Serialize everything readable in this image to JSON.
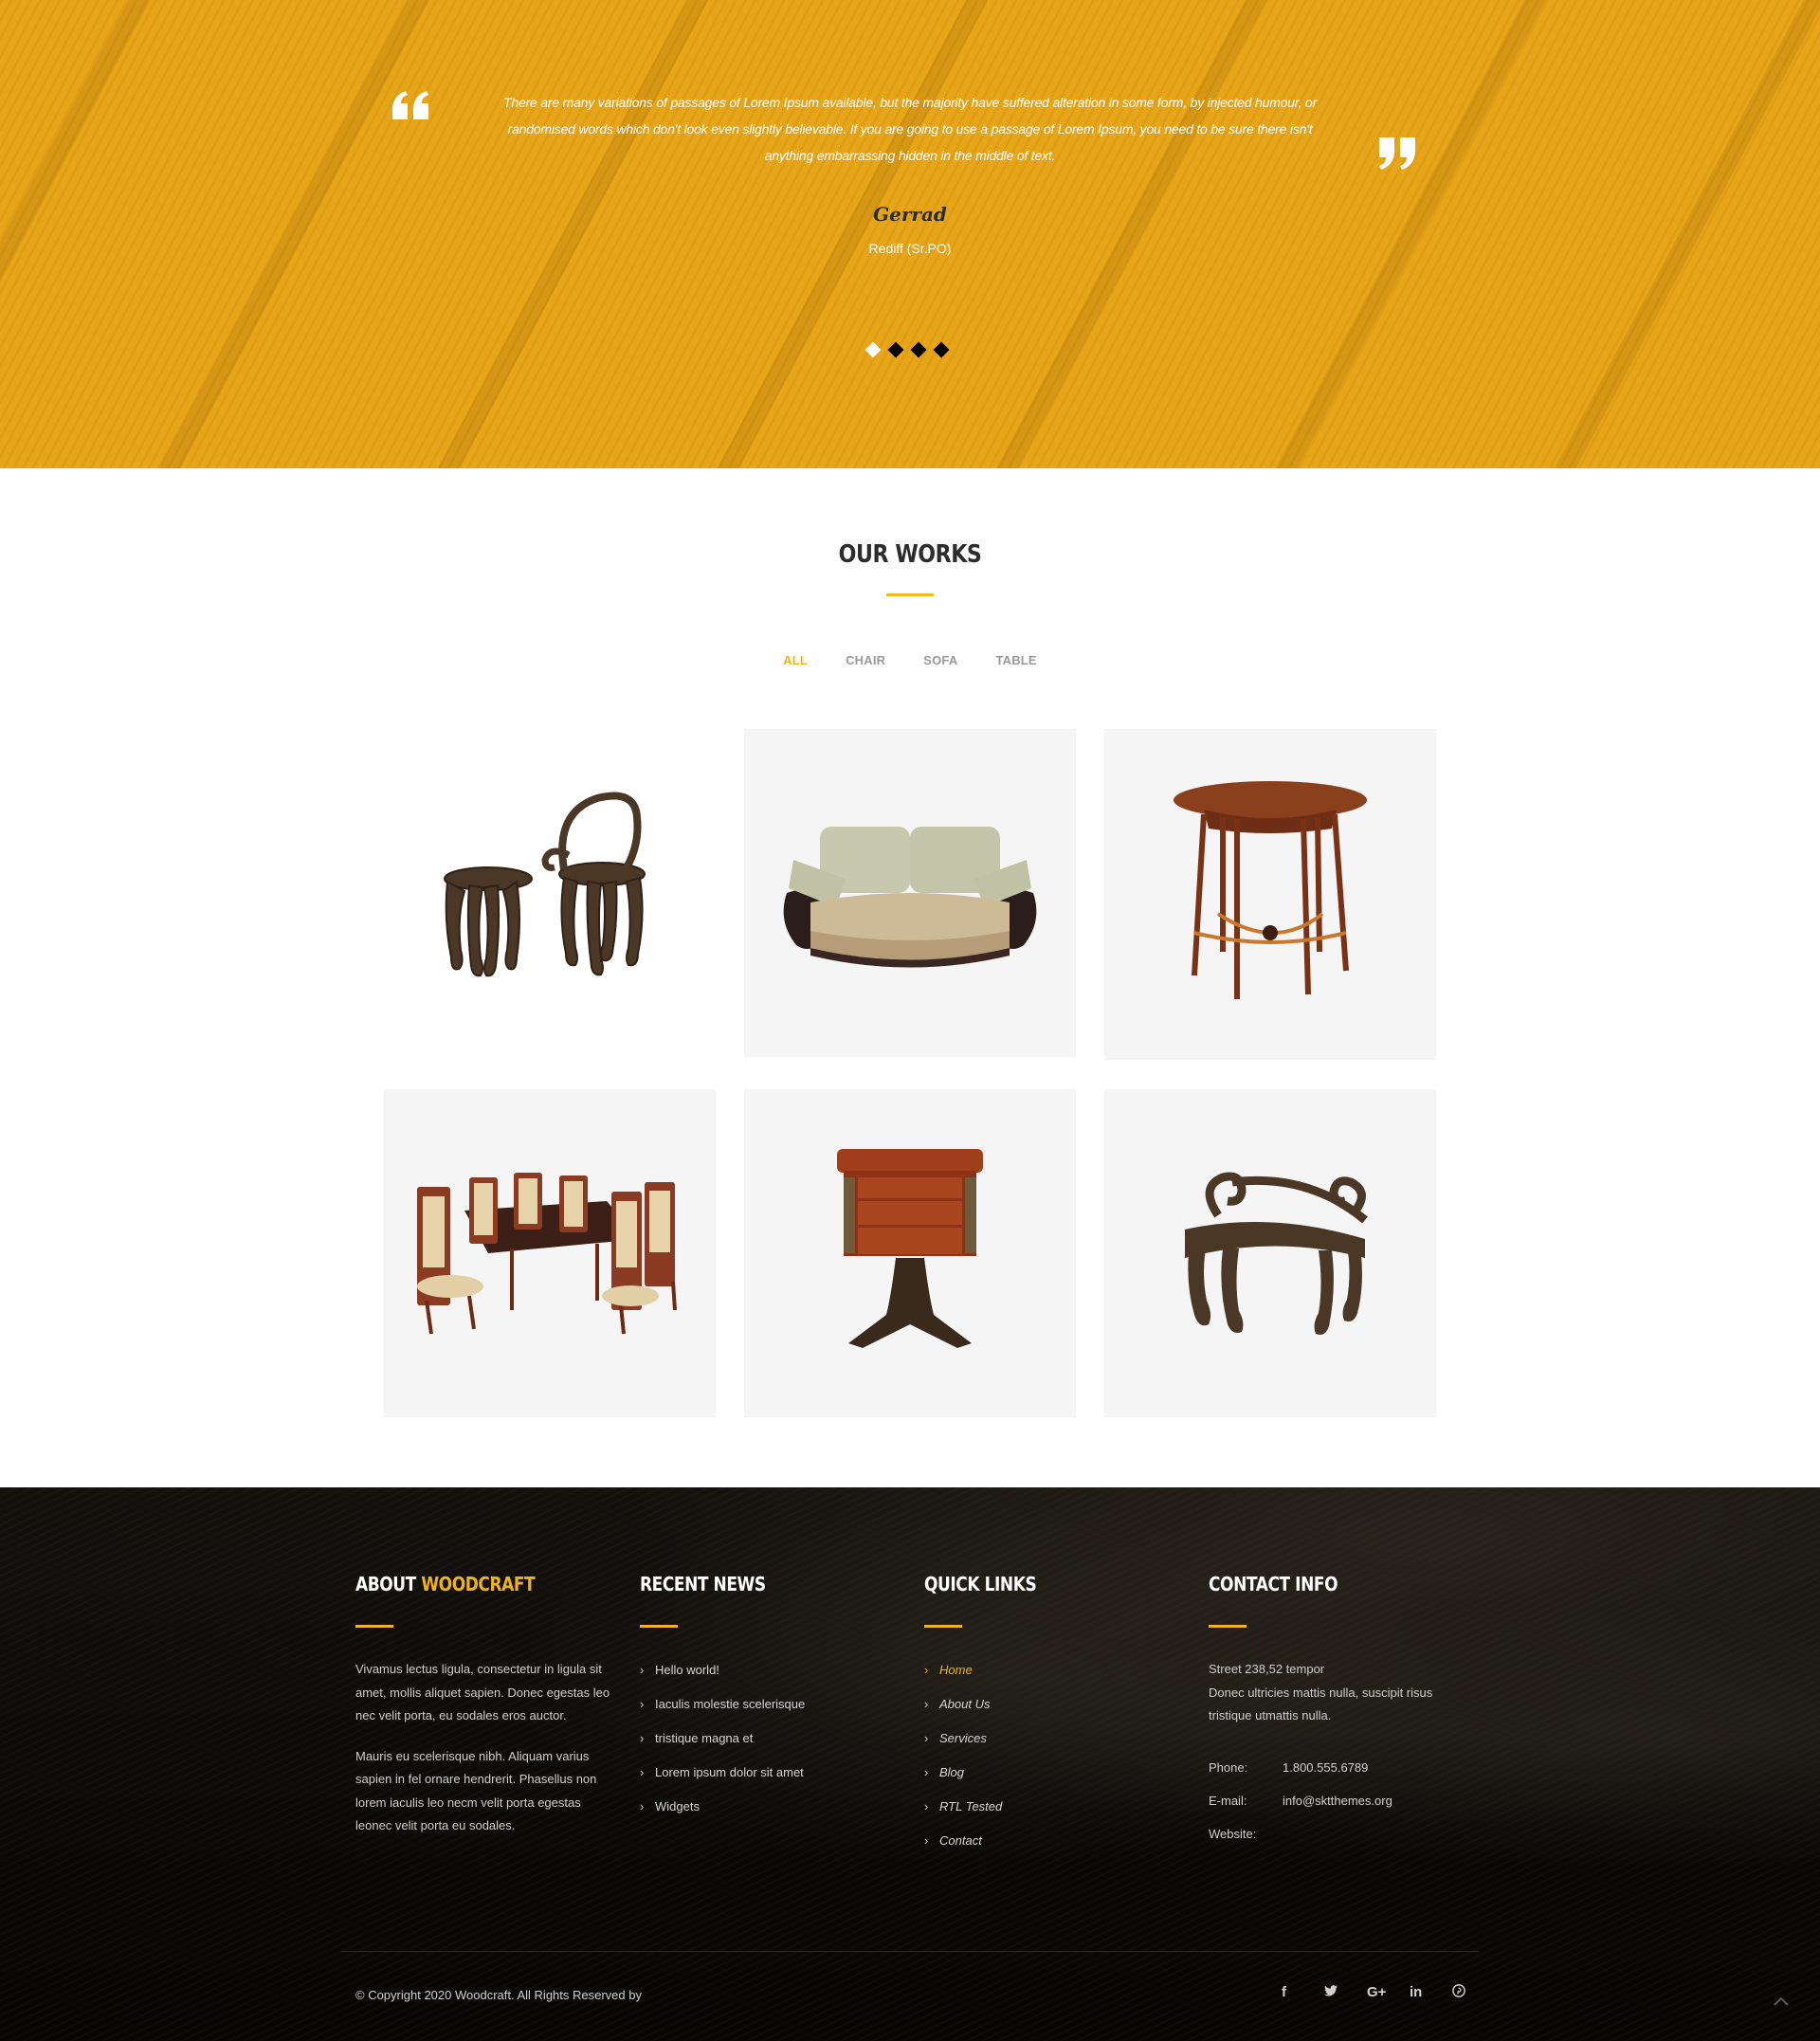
{
  "testimonial": {
    "quote": "There are many variations of passages of Lorem Ipsum available, but the majority have suffered alteration in some form, by injected humour, or randomised words which don't look even slightly believable. If you are going to use a passage of Lorem Ipsum, you need to be sure there isn't anything embarrassing hidden in the middle of text.",
    "author": "Gerrad",
    "role": "Rediff (Sr.PO)",
    "slides_total": 4,
    "active_slide": 1,
    "accent_color": "#e6a417"
  },
  "works": {
    "title": "OUR WORKS",
    "filters": [
      {
        "label": "ALL",
        "active": true
      },
      {
        "label": "CHAIR",
        "active": false
      },
      {
        "label": "SOFA",
        "active": false
      },
      {
        "label": "TABLE",
        "active": false
      }
    ],
    "items": [
      {
        "image": "carved-chair-and-stool"
      },
      {
        "image": "floral-sofa"
      },
      {
        "image": "round-wooden-table"
      },
      {
        "image": "dining-table-set"
      },
      {
        "image": "antique-chest-table"
      },
      {
        "image": "carved-bench"
      }
    ]
  },
  "footer": {
    "about": {
      "heading_prefix": "ABOUT",
      "heading_accent": "WOODCRAFT",
      "paragraphs": [
        "Vivamus lectus ligula, consectetur in ligula sit amet, mollis aliquet sapien. Donec egestas leo nec velit porta, eu sodales eros auctor.",
        "Mauris eu scelerisque nibh. Aliquam varius sapien in fel ornare hendrerit. Phasellus non lorem iaculis leo necm velit porta egestas leonec velit porta eu sodales."
      ]
    },
    "news": {
      "heading": "RECENT NEWS",
      "items": [
        "Hello world!",
        "Iaculis molestie scelerisque",
        "tristique magna et",
        "Lorem ipsum dolor sit amet",
        "Widgets"
      ]
    },
    "links": {
      "heading": "QUICK LINKS",
      "items": [
        "Home",
        "About Us",
        "Services",
        "Blog",
        "RTL Tested",
        "Contact"
      ],
      "active": "Home"
    },
    "contact": {
      "heading": "CONTACT INFO",
      "address_line1": "Street 238,52 tempor",
      "address_line2": "Donec ultricies mattis nulla, suscipit risus tristique utmattis nulla.",
      "phone_label": "Phone:",
      "phone": "1.800.555.6789",
      "email_label": "E-mail:",
      "email": "info@sktthemes.org",
      "website_label": "Website:",
      "website": ""
    },
    "copyright": "© Copyright 2020 Woodcraft. All Rights Reserved by",
    "social": [
      {
        "name": "facebook",
        "glyph": "f"
      },
      {
        "name": "twitter",
        "glyph": "🐦"
      },
      {
        "name": "google-plus",
        "glyph": "G+"
      },
      {
        "name": "linkedin",
        "glyph": "in"
      },
      {
        "name": "pinterest",
        "glyph": "℗"
      }
    ],
    "accent_color": "#f0b416"
  }
}
